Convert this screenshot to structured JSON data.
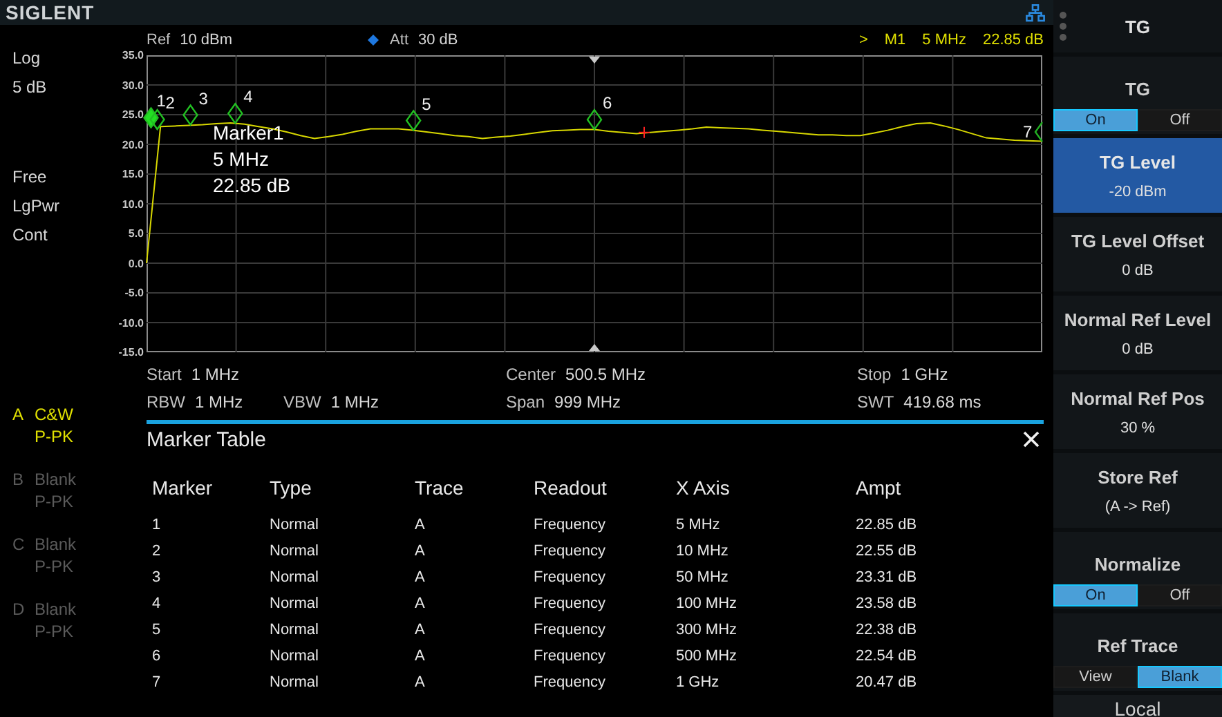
{
  "brand": "SIGLENT",
  "header": {
    "ref": {
      "label": "Ref",
      "value": "10 dBm"
    },
    "att": {
      "label": "Att",
      "value": "30 dB"
    },
    "marker_readout": {
      "arrow": ">",
      "marker": "M1",
      "frequency": "5 MHz",
      "amplitude": "22.85 dB"
    }
  },
  "left_panel": {
    "scale_type": "Log",
    "scale_div": "5 dB",
    "settings": [
      "Free",
      "LgPwr",
      "Cont"
    ],
    "traces": [
      {
        "letter": "A",
        "mode": "C&W",
        "detector": "P-PK",
        "active": true
      },
      {
        "letter": "B",
        "mode": "Blank",
        "detector": "P-PK",
        "active": false
      },
      {
        "letter": "C",
        "mode": "Blank",
        "detector": "P-PK",
        "active": false
      },
      {
        "letter": "D",
        "mode": "Blank",
        "detector": "P-PK",
        "active": false
      }
    ]
  },
  "plot": {
    "chart_data": {
      "type": "line",
      "ylim": [
        -15,
        35
      ],
      "grid": true,
      "yticks": [
        {
          "value": 35,
          "label": "35.0"
        },
        {
          "value": 30,
          "label": "30.0"
        },
        {
          "value": 25,
          "label": "25.0"
        },
        {
          "value": 20,
          "label": "20.0"
        },
        {
          "value": 15,
          "label": "15.0"
        },
        {
          "value": 10,
          "label": "10.0"
        },
        {
          "value": 5,
          "label": "5.0"
        },
        {
          "value": 0,
          "label": "0.0"
        },
        {
          "value": -5,
          "label": "-5.0"
        },
        {
          "value": -10,
          "label": "-10.0"
        },
        {
          "value": -15,
          "label": "-15.0"
        }
      ],
      "categories": [
        null,
        null,
        null,
        null,
        null,
        null,
        null,
        null,
        null,
        null,
        null,
        null,
        null,
        null,
        null,
        null,
        null,
        null,
        null,
        null,
        null,
        null,
        null,
        null,
        null,
        null,
        null,
        null,
        null,
        null,
        null,
        null,
        null,
        null,
        null,
        null,
        null,
        null,
        null,
        null,
        null,
        null,
        null,
        null,
        null,
        null,
        null,
        null,
        null,
        null,
        null,
        null,
        null,
        null,
        null,
        null,
        null,
        null,
        null,
        null,
        null,
        null,
        null,
        null,
        null
      ],
      "series": [
        {
          "color": "#d8d800",
          "values": [
            0.0,
            23.0,
            23.1,
            23.2,
            23.3,
            23.5,
            23.6,
            23.4,
            23.0,
            22.6,
            22.1,
            21.5,
            21.0,
            21.3,
            21.7,
            22.2,
            22.6,
            22.6,
            22.6,
            22.4,
            22.1,
            21.8,
            21.5,
            21.3,
            21.0,
            21.2,
            21.4,
            21.7,
            22.0,
            22.3,
            22.4,
            22.5,
            22.5,
            22.2,
            22.0,
            21.8,
            22.0,
            22.2,
            22.4,
            22.6,
            22.9,
            22.8,
            22.7,
            22.6,
            22.4,
            22.2,
            22.0,
            21.8,
            21.6,
            21.6,
            21.5,
            21.5,
            21.9,
            22.4,
            23.0,
            23.5,
            23.6,
            23.1,
            22.5,
            21.8,
            21.1,
            20.9,
            20.7,
            20.6,
            20.5
          ]
        }
      ]
    },
    "markers": [
      {
        "label": "1",
        "active": true
      },
      {
        "label": "2",
        "active": false
      },
      {
        "label": "3",
        "active": false
      },
      {
        "label": "4",
        "active": false
      },
      {
        "label": "5",
        "active": false
      },
      {
        "label": "6",
        "active": false
      },
      {
        "label": "7",
        "active": false
      }
    ],
    "marker_info": {
      "name": "Marker1",
      "frequency": "5 MHz",
      "amplitude": "22.85 dB"
    }
  },
  "sweep_info": {
    "start": {
      "label": "Start",
      "value": "1 MHz"
    },
    "rbw": {
      "label": "RBW",
      "value": "1 MHz"
    },
    "vbw": {
      "label": "VBW",
      "value": "1 MHz"
    },
    "center": {
      "label": "Center",
      "value": "500.5 MHz"
    },
    "span": {
      "label": "Span",
      "value": "999 MHz"
    },
    "stop": {
      "label": "Stop",
      "value": "1 GHz"
    },
    "swt": {
      "label": "SWT",
      "value": "419.68 ms"
    }
  },
  "marker_table": {
    "title": "Marker Table",
    "columns": [
      "Marker",
      "Type",
      "Trace",
      "Readout",
      "X Axis",
      "Ampt"
    ],
    "rows": [
      [
        "1",
        "Normal",
        "A",
        "Frequency",
        "5 MHz",
        "22.85 dB"
      ],
      [
        "2",
        "Normal",
        "A",
        "Frequency",
        "10 MHz",
        "22.55 dB"
      ],
      [
        "3",
        "Normal",
        "A",
        "Frequency",
        "50 MHz",
        "23.31 dB"
      ],
      [
        "4",
        "Normal",
        "A",
        "Frequency",
        "100 MHz",
        "23.58 dB"
      ],
      [
        "5",
        "Normal",
        "A",
        "Frequency",
        "300 MHz",
        "22.38 dB"
      ],
      [
        "6",
        "Normal",
        "A",
        "Frequency",
        "500 MHz",
        "22.54 dB"
      ],
      [
        "7",
        "Normal",
        "A",
        "Frequency",
        "1 GHz",
        "20.47 dB"
      ]
    ]
  },
  "softkeys": {
    "title": "TG",
    "items": [
      {
        "kind": "toggle",
        "label": "TG",
        "options": [
          {
            "label": "On",
            "selected": true
          },
          {
            "label": "Off",
            "selected": false
          }
        ]
      },
      {
        "kind": "value",
        "label": "TG Level",
        "value": "-20 dBm",
        "selected": true
      },
      {
        "kind": "value",
        "label": "TG Level Offset",
        "value": "0 dB",
        "selected": false
      },
      {
        "kind": "value",
        "label": "Normal Ref Level",
        "value": "0 dB",
        "selected": false
      },
      {
        "kind": "value",
        "label": "Normal Ref Pos",
        "value": "30 %",
        "selected": false
      },
      {
        "kind": "value",
        "label": "Store Ref",
        "value": "(A -> Ref)",
        "selected": false
      },
      {
        "kind": "toggle",
        "label": "Normalize",
        "options": [
          {
            "label": "On",
            "selected": true
          },
          {
            "label": "Off",
            "selected": false
          }
        ]
      },
      {
        "kind": "toggle",
        "label": "Ref Trace",
        "options": [
          {
            "label": "View",
            "selected": false
          },
          {
            "label": "Blank",
            "selected": true
          }
        ]
      }
    ],
    "status": "Local"
  }
}
